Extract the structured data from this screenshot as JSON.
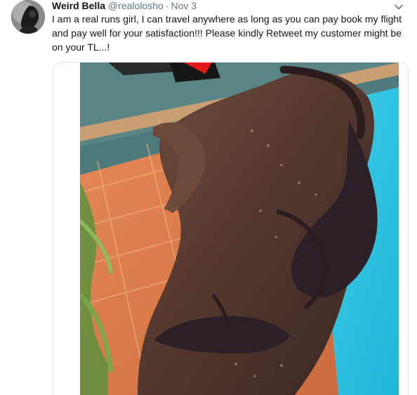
{
  "tweet": {
    "author_name": "Weird Bella",
    "handle": "@realolosho",
    "separator": "·",
    "time": "Nov 3",
    "text": "I am a real runs girl, I can travel anywhere as long as you can pay book my flight and pay well for your satisfaction!!! Please kindly Retweet my customer might be on your TL...!",
    "menu_icon": "chevron-down-icon",
    "media_type": "photo"
  }
}
